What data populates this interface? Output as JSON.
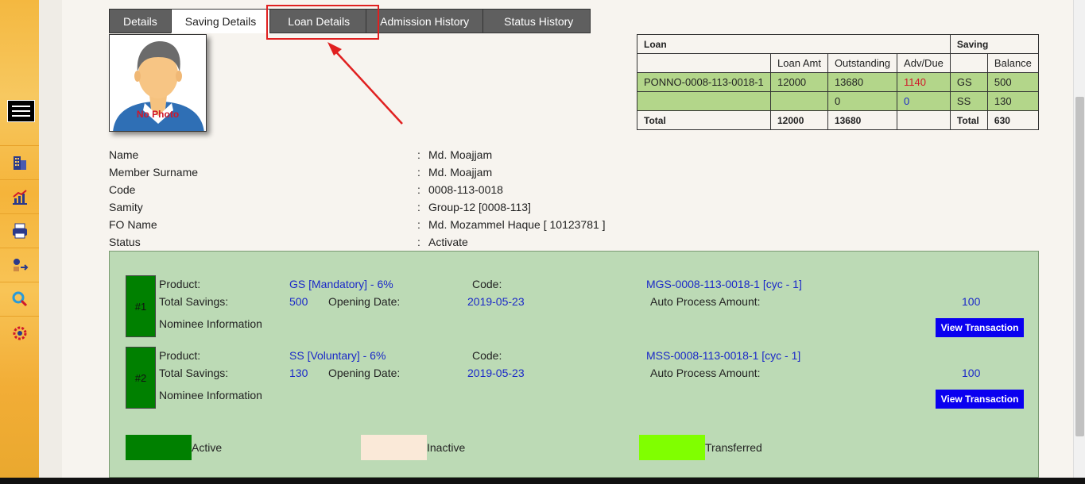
{
  "tabs": [
    "Details",
    "Saving Details",
    "Loan Details",
    "Admission History",
    "Status History"
  ],
  "photo": {
    "placeholder_text": "No Photo"
  },
  "summary": {
    "loan_header": "Loan",
    "saving_header": "Saving",
    "columns": [
      "Loan Amt",
      "Outstanding",
      "Adv/Due",
      "Balance"
    ],
    "rows": [
      {
        "loan_no": "PONNO-0008-113-0018-1",
        "loan_amt": "12000",
        "outstanding": "13680",
        "adv_due": "1140",
        "saving_type": "GS",
        "balance": "500"
      },
      {
        "loan_no": "",
        "loan_amt": "",
        "outstanding": "0",
        "adv_due": "0",
        "saving_type": "SS",
        "balance": "130"
      }
    ],
    "total_label": "Total",
    "total_loan_amt": "12000",
    "total_outstanding": "13680",
    "saving_total_label": "Total",
    "total_balance": "630"
  },
  "member": {
    "colon": ":",
    "fields": [
      {
        "label": "Name",
        "value": "Md. Moajjam"
      },
      {
        "label": "Member Surname",
        "value": "Md. Moajjam"
      },
      {
        "label": "Code",
        "value": "0008-113-0018"
      },
      {
        "label": "Samity",
        "value": "Group-12 [0008-113]"
      },
      {
        "label": "FO Name",
        "value": "Md. Mozammel Haque [ 10123781 ]"
      },
      {
        "label": "Status",
        "value": "Activate"
      }
    ]
  },
  "accounts": [
    {
      "num": "#1",
      "product_label": "Product:",
      "product": "GS [Mandatory] - 6%",
      "code_label": "Code:",
      "code": "MGS-0008-113-0018-1 [cyc - 1]",
      "total_label": "Total Savings:",
      "total": "500",
      "open_label": "Opening Date:",
      "open_date": "2019-05-23",
      "auto_label": "Auto Process Amount:",
      "auto": "100",
      "nominee": "Nominee Information",
      "button": "View Transaction"
    },
    {
      "num": "#2",
      "product_label": "Product:",
      "product": "SS [Voluntary] - 6%",
      "code_label": "Code:",
      "code": "MSS-0008-113-0018-1 [cyc - 1]",
      "total_label": "Total Savings:",
      "total": "130",
      "open_label": "Opening Date:",
      "open_date": "2019-05-23",
      "auto_label": "Auto Process Amount:",
      "auto": "100",
      "nominee": "Nominee Information",
      "button": "View Transaction"
    }
  ],
  "legend": [
    {
      "label": "Active",
      "color": "#008000"
    },
    {
      "label": "Inactive",
      "color": "#fae9d8"
    },
    {
      "label": "Transferred",
      "color": "#80ff00"
    }
  ],
  "sidebar_icons": [
    "building-icon",
    "chart-icon",
    "printer-icon",
    "transfer-icon",
    "search-settings-icon",
    "gear-icon"
  ]
}
